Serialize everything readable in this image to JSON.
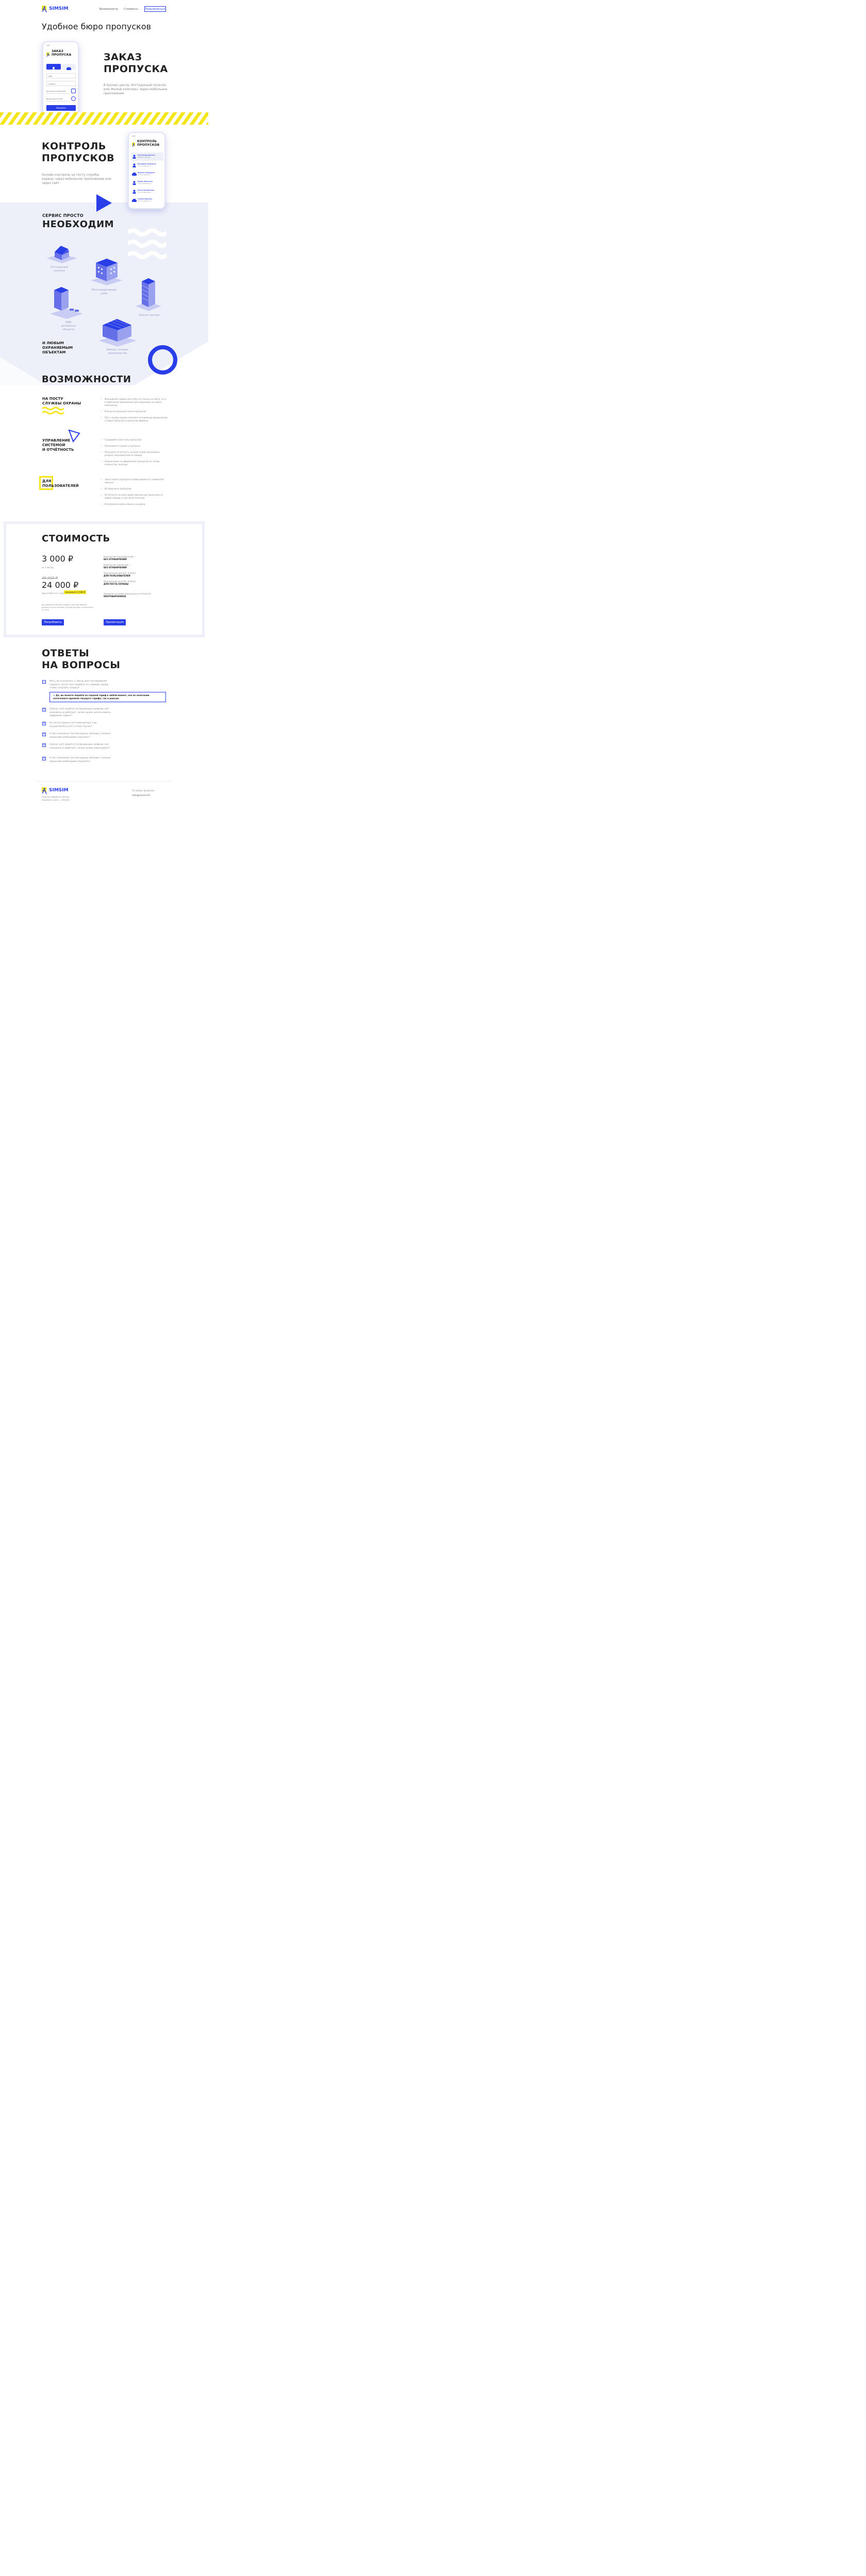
{
  "header": {
    "logo": "SIMSIM",
    "nav": [
      "Возможности",
      "Стоимость"
    ],
    "connect": "Подключиться"
  },
  "hero": {
    "title": "Удобное бюро пропусков"
  },
  "order": {
    "title_line1": "ЗАКАЗ",
    "title_line2": "ПРОПУСКА",
    "description": "В Бизнес-центр, Коттеджный поселок или Жилой комплекс через мобильное приложение",
    "phone": {
      "status_time": "9:41",
      "app_title_line1": "ЗАКАЗ",
      "app_title_line2": "ПРОПУСКА",
      "field_name": "ФИО",
      "field_phone": "Телефон",
      "field_date": "Дата визита 18.08.2020",
      "field_time": "Время визита 14:00",
      "submit": "Заказать"
    }
  },
  "control": {
    "title_line1": "КОНТРОЛЬ",
    "title_line2": "ПРОПУСКОВ",
    "description": "Онлайн контроль на посту службы охраны через мобильное приложение или через сайт",
    "phone": {
      "status_time": "9:41",
      "app_title_line1": "КОНТРОЛЬ",
      "app_title_line2": "ПРОПУСКОВ",
      "list": [
        {
          "name": "Александр Фролов",
          "sub": "Здание 4, въезд 2"
        },
        {
          "name": "Владимир Муравьев",
          "sub": "Гость в квартиру 5"
        },
        {
          "name": "Марина Свиридова",
          "sub": "Гость в квартиру 7"
        },
        {
          "name": "Мария Денисова",
          "sub": "Гость в квартиру 3"
        },
        {
          "name": "Анатолий Винокур",
          "sub": "Гость в квартиру 8"
        },
        {
          "name": "Галина Иванова",
          "sub": "Гость в квартиру 2"
        }
      ]
    }
  },
  "service": {
    "title_small": "СЕРВИС ПРОСТО",
    "title_big": "НЕОБХОДИМ",
    "objects": [
      "Коттеджные посёлки",
      "Многоквартирные дома",
      "Бизнес-центры",
      "НИИ, режимные объекты",
      "Заводы, склады, производства"
    ],
    "any_line1": "И ЛЮБЫМ",
    "any_line2": "ОХРАНЯЕМЫМ",
    "any_line3": "ОБЪЕКТАМ"
  },
  "features": {
    "title": "ВОЗМОЖНОСТИ",
    "groups": [
      {
        "title_line1": "НА ПОСТУ",
        "title_line2": "СЛУЖБЫ ОХРАНЫ",
        "items": [
          "Функционал сервиса доступен не только на сайте, но и в мобильном приложении (для охранника не нужен компьютер)",
          "Всегда актуальный список пропусков",
          "Пост службы охраны получает мгновенные уведомления о новых пропусках в реальном времени"
        ]
      },
      {
        "title_line1": "УПРАВЛЕНИЕ",
        "title_line2": "СИСТЕМОЙ",
        "title_line3": "И ОТЧЁТНОСТЬ",
        "items": [
          "Создавайте свои типы пропусков",
          "Назначайте стоимость пропуска",
          "Получайте отчетность по всем типам пропусков в разрезе пользователей за период",
          "Ограничение на оформление пропусков по типам, количеству, полосам"
        ]
      },
      {
        "title_line1": "ДЛЯ",
        "title_line2": "ПОЛЬЗОВАТЕЛЕЙ",
        "items": [
          "Заказ нового пропуска в любое время из 2 кликов без звонков",
          "История всех пропусков",
          "Отчётность по всем своим заказанным пропускам за любой период, в том числе платным",
          "Встроенная кнопка звонка на охрану"
        ]
      }
    ]
  },
  "pricing": {
    "title": "СТОИМОСТЬ",
    "price_month": "3 000 ₽",
    "per_month": "за 1 месяц",
    "old_price": "36 000 ₽",
    "price_year": "24 000 ₽",
    "per_year": "при оплате за 1 год",
    "saving": "экономия 12 000 ₽",
    "refund_note": "Мы уверены в нашем сервисе, поэтому вернем деньги, если в течение 14 дней вы вдруг откажетесь от него",
    "try_button": "Попробовать",
    "presentation_button": "Презентация",
    "specs": [
      {
        "label": "Количество пользователей —",
        "value": "БЕЗ ОГРАНИЧЕНИЙ"
      },
      {
        "label": "Количество пропусков —",
        "value": "БЕЗ ОГРАНИЧЕНИЙ"
      },
      {
        "label": "Приложение для iOS, Android",
        "value": "ДЛЯ ПОЛЬЗОВАТЕЛЕЙ"
      },
      {
        "label": "Приложение для iOS, Android",
        "value": "ДЛЯ ПОСТА ОХРАНЫ"
      },
      {
        "label": "Хранение истории пропусков и отчётности",
        "value": "НЕОГРАНИЧЕННОЕ"
      }
    ]
  },
  "faq": {
    "title_line1": "ОТВЕТЫ",
    "title_line2": "НА ВОПРОСЫ",
    "items": [
      {
        "sign": "−",
        "q": "Могу ли я оплатить 1 месяц для тестирования сервиса, после чего перейти на годовой тариф, чтобы получить скидку?",
        "answer": "— Да, вы можете перейти на годовой тариф в любой момент, как по окончании оплаченного времени текущего тарифа, так и раньше."
      },
      {
        "sign": "+",
        "q": "Сейчас учёт ведётся по бумажным заявкам, всё налажено и работает, зачем нужно использовать цифровой сервис?"
      },
      {
        "sign": "+",
        "q": "На посту охраны нет компьютера, как осуществлять учёт в этом случае?"
      },
      {
        "sign": "+",
        "q": "У нас несколько постов охраны (въезда), сколько лицензий необходимо покупать?"
      },
      {
        "sign": "+",
        "q": "Сейчас учёт ведётся по бумажным заявкам, все налажено и работает, зачем нужно переходить?"
      },
      {
        "sign": "+",
        "q": "У нас несколько постов охраны (въезда), сколько лицензий необходимо покупать?"
      }
    ]
  },
  "footer": {
    "logo": "SIMSIM",
    "policy": "Политика обработки данных",
    "developer": "Разработка сайта — ARKADIA",
    "contact_label": "По любым вопросам:",
    "email": "hello@simsim.life"
  },
  "colors": {
    "accent": "#2a3ee8",
    "yellow": "#f5e61c",
    "light": "#eef0f9"
  }
}
